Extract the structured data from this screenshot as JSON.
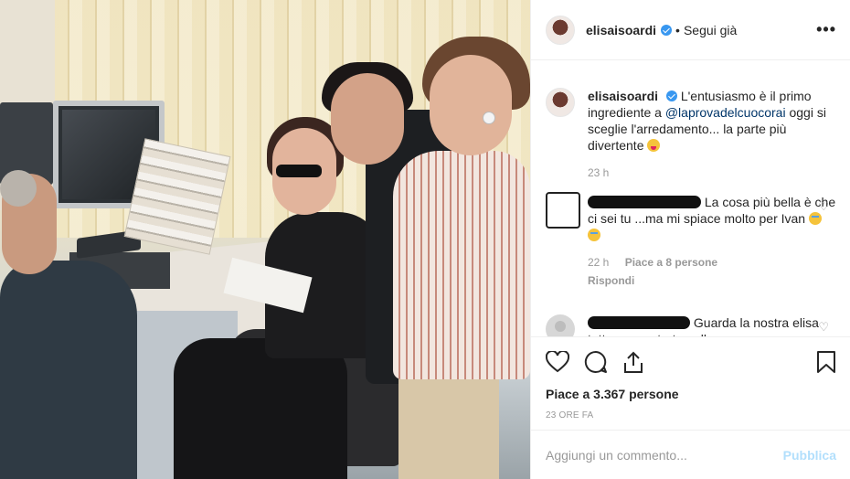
{
  "post": {
    "username": "elisaisoardi",
    "follow_status": "Segui già",
    "separator": "•",
    "more": "•••"
  },
  "caption": {
    "username": "elisaisoardi",
    "text_before": "L'entusiasmo è il primo ingrediente a ",
    "mention": "@laprovadelcuocorai",
    "text_after": " oggi si sceglie l'arredamento... la parte più divertente",
    "time": "23 h"
  },
  "comments": [
    {
      "text": "La cosa più bella è che ci sei tu ...ma mi spiace molto per Ivan",
      "time": "22 h",
      "likes": "Piace a 8 persone",
      "reply": "Rispondi"
    },
    {
      "text": "Guarda la nostra elisa tutta concentrata nella"
    }
  ],
  "stats": {
    "likes": "Piace a 3.367 persone",
    "posted": "23 ORE FA"
  },
  "composer": {
    "placeholder": "Aggiungi un commento...",
    "publish": "Pubblica"
  },
  "icons": {
    "like": "heart-icon",
    "comment": "comment-icon",
    "share": "share-icon",
    "save": "bookmark-icon",
    "verified": "verified-badge-icon",
    "options": "more-options-icon"
  },
  "colors": {
    "link": "#003569",
    "verified": "#3897f0",
    "muted": "#999999",
    "publish_disabled": "#b2dffc"
  }
}
